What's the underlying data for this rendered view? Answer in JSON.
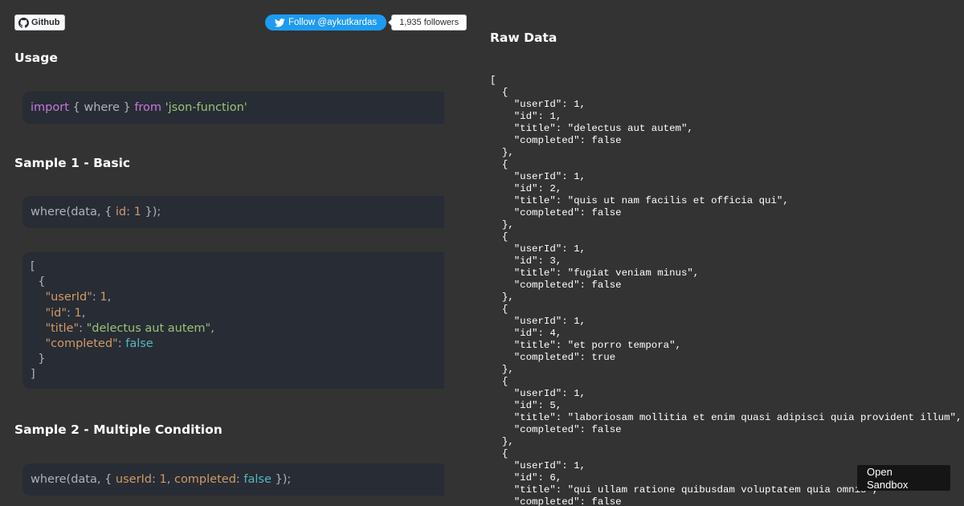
{
  "header": {
    "github_label": "Github",
    "follow_label": "Follow @aykutkardas",
    "followers_count": "1,935 followers"
  },
  "sections": {
    "usage": {
      "title": "Usage",
      "code": [
        {
          "t": "import",
          "c": "kw"
        },
        {
          "t": " { where } ",
          "c": "plain"
        },
        {
          "t": "from",
          "c": "kw"
        },
        {
          "t": " ",
          "c": "plain"
        },
        {
          "t": "'json-function'",
          "c": "str"
        }
      ]
    },
    "sample1": {
      "title": "Sample 1 - Basic",
      "code": [
        {
          "t": "where(data, { ",
          "c": "plain"
        },
        {
          "t": "id",
          "c": "key"
        },
        {
          "t": ": ",
          "c": "plain"
        },
        {
          "t": "1",
          "c": "num"
        },
        {
          "t": " });",
          "c": "plain"
        }
      ],
      "result_lines": [
        [
          {
            "t": "[",
            "c": "plain"
          }
        ],
        [
          {
            "t": "  {",
            "c": "plain"
          }
        ],
        [
          {
            "t": "    ",
            "c": "plain"
          },
          {
            "t": "\"userId\"",
            "c": "key"
          },
          {
            "t": ": ",
            "c": "plain"
          },
          {
            "t": "1",
            "c": "num"
          },
          {
            "t": ",",
            "c": "plain"
          }
        ],
        [
          {
            "t": "    ",
            "c": "plain"
          },
          {
            "t": "\"id\"",
            "c": "key"
          },
          {
            "t": ": ",
            "c": "plain"
          },
          {
            "t": "1",
            "c": "num"
          },
          {
            "t": ",",
            "c": "plain"
          }
        ],
        [
          {
            "t": "    ",
            "c": "plain"
          },
          {
            "t": "\"title\"",
            "c": "key"
          },
          {
            "t": ": ",
            "c": "plain"
          },
          {
            "t": "\"delectus aut autem\"",
            "c": "str"
          },
          {
            "t": ",",
            "c": "plain"
          }
        ],
        [
          {
            "t": "    ",
            "c": "plain"
          },
          {
            "t": "\"completed\"",
            "c": "key"
          },
          {
            "t": ": ",
            "c": "plain"
          },
          {
            "t": "false",
            "c": "bool"
          }
        ],
        [
          {
            "t": "  }",
            "c": "plain"
          }
        ],
        [
          {
            "t": "]",
            "c": "plain"
          }
        ]
      ]
    },
    "sample2": {
      "title": "Sample 2 - Multiple Condition",
      "code": [
        {
          "t": "where(data, { ",
          "c": "plain"
        },
        {
          "t": "userId",
          "c": "key"
        },
        {
          "t": ": ",
          "c": "plain"
        },
        {
          "t": "1",
          "c": "num"
        },
        {
          "t": ", ",
          "c": "plain"
        },
        {
          "t": "completed",
          "c": "key"
        },
        {
          "t": ": ",
          "c": "plain"
        },
        {
          "t": "false",
          "c": "bool"
        },
        {
          "t": " });",
          "c": "plain"
        }
      ]
    }
  },
  "raw_data": {
    "title": "Raw Data",
    "text": "[\n  {\n    \"userId\": 1,\n    \"id\": 1,\n    \"title\": \"delectus aut autem\",\n    \"completed\": false\n  },\n  {\n    \"userId\": 1,\n    \"id\": 2,\n    \"title\": \"quis ut nam facilis et officia qui\",\n    \"completed\": false\n  },\n  {\n    \"userId\": 1,\n    \"id\": 3,\n    \"title\": \"fugiat veniam minus\",\n    \"completed\": false\n  },\n  {\n    \"userId\": 1,\n    \"id\": 4,\n    \"title\": \"et porro tempora\",\n    \"completed\": true\n  },\n  {\n    \"userId\": 1,\n    \"id\": 5,\n    \"title\": \"laboriosam mollitia et enim quasi adipisci quia provident illum\",\n    \"completed\": false\n  },\n  {\n    \"userId\": 1,\n    \"id\": 6,\n    \"title\": \"qui ullam ratione quibusdam voluptatem quia omnis\",\n    \"completed\": false"
  },
  "sandbox": {
    "line1": "Open",
    "line2": "Sandbox"
  },
  "icons": {
    "github": "github-icon",
    "twitter": "twitter-bird-icon"
  },
  "colors": {
    "background": "#333333",
    "code_background": "#282c34",
    "twitter_blue": "#1d9bf0"
  }
}
